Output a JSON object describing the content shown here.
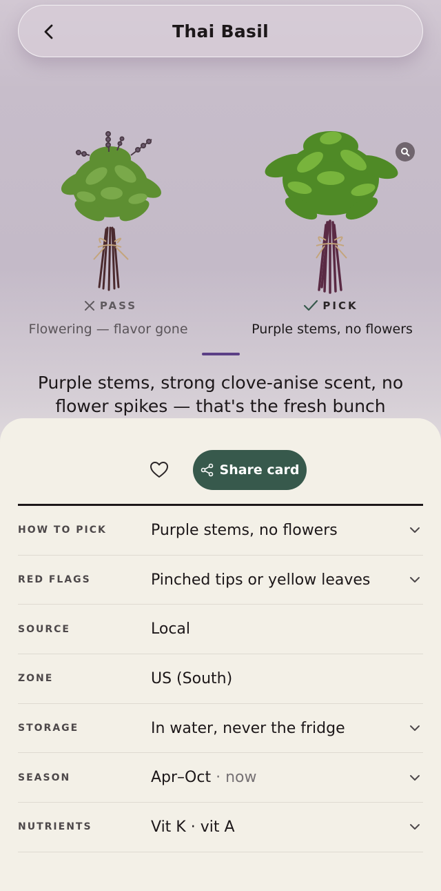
{
  "header": {
    "title": "Thai Basil"
  },
  "compare": {
    "pass": {
      "verdict": "PASS",
      "caption": "Flowering — flavor gone",
      "icon": "x-icon"
    },
    "pick": {
      "verdict": "PICK",
      "caption": "Purple stems, no flowers",
      "icon": "check-icon"
    }
  },
  "summary": "Purple stems, strong clove-anise scent, no flower spikes — that's the fresh bunch",
  "actions": {
    "share_label": "Share card"
  },
  "details": [
    {
      "label": "HOW TO PICK",
      "value": "Purple stems, no flowers",
      "expandable": true
    },
    {
      "label": "RED FLAGS",
      "value": "Pinched tips or yellow leaves",
      "expandable": true
    },
    {
      "label": "SOURCE",
      "value": "Local",
      "expandable": false
    },
    {
      "label": "ZONE",
      "value": "US (South)",
      "expandable": false
    },
    {
      "label": "STORAGE",
      "value": "In water, never the fridge",
      "expandable": true
    },
    {
      "label": "SEASON",
      "value": "Apr–Oct",
      "value_suffix": "· now",
      "expandable": true
    },
    {
      "label": "NUTRIENTS",
      "value": "Vit K · vit A",
      "expandable": true
    }
  ],
  "colors": {
    "accent": "#37594c",
    "indicator": "#5b3f86",
    "sheet": "#f3f0e7"
  }
}
